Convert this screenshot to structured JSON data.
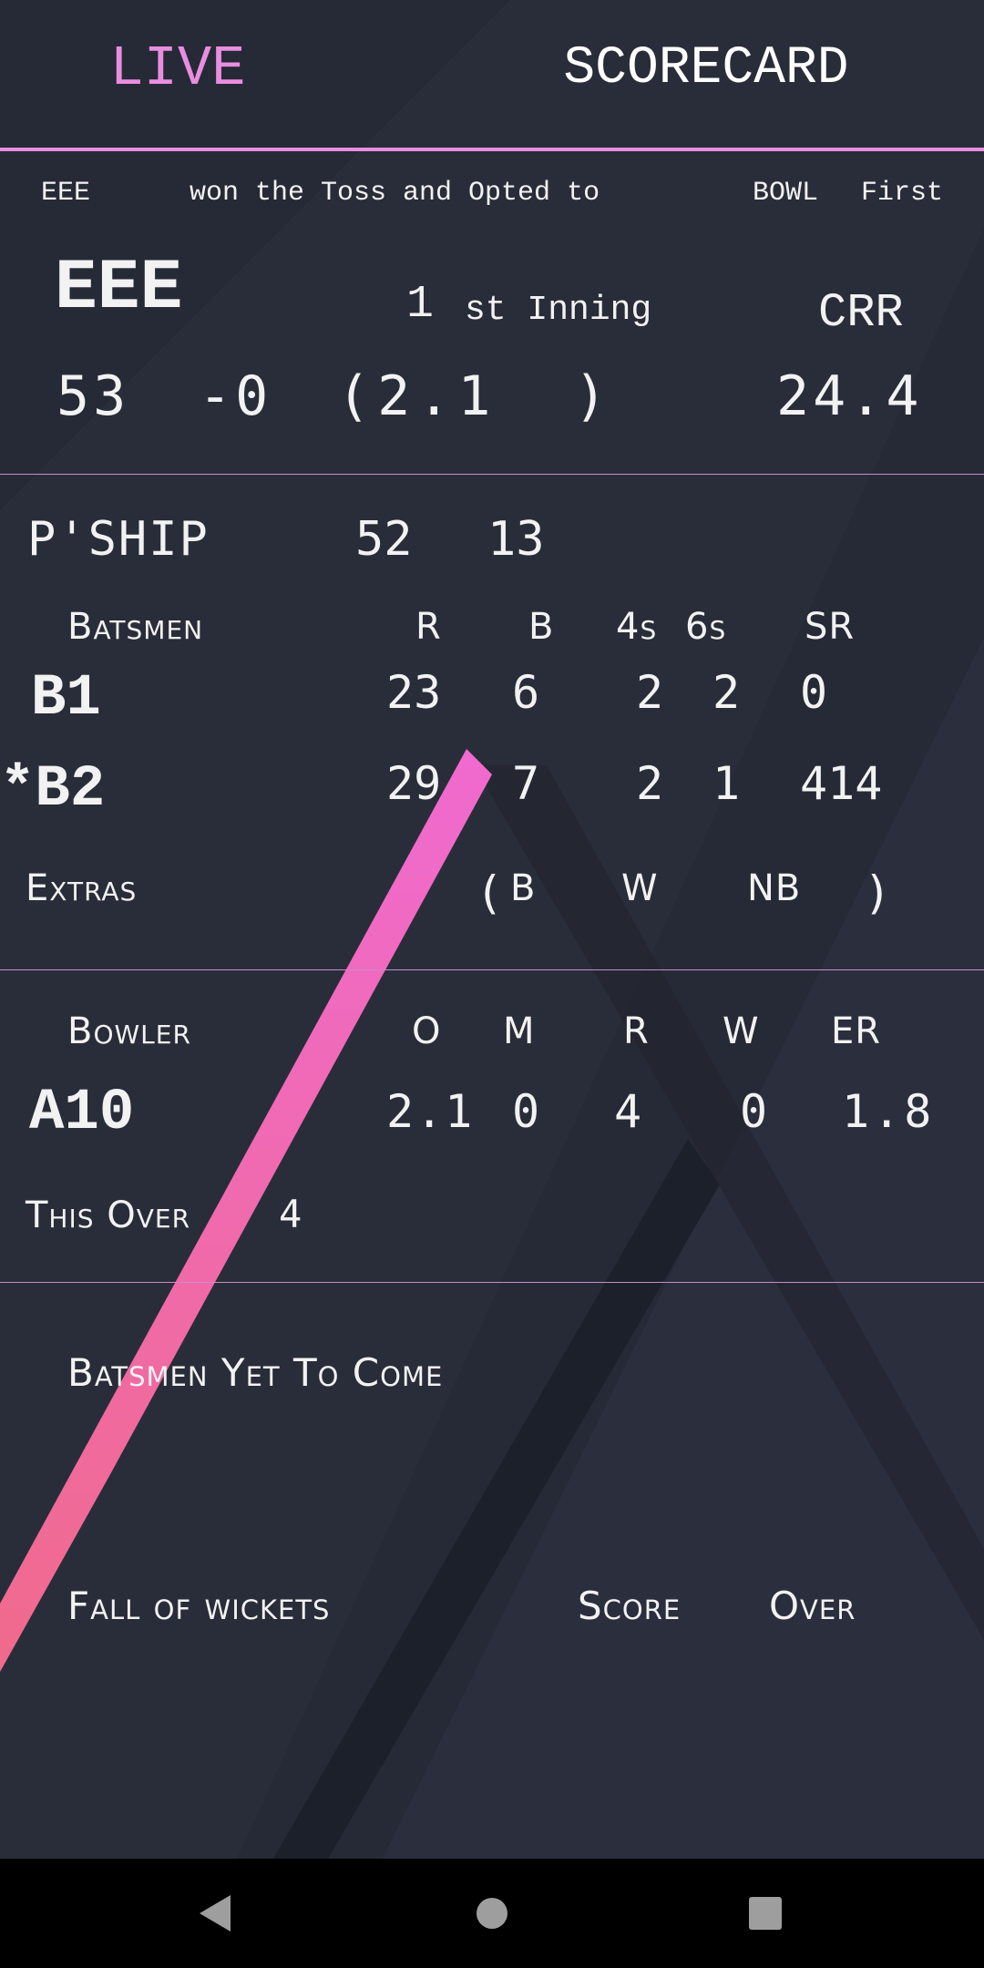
{
  "tabs": {
    "live": "LIVE",
    "scorecard": "SCORECARD"
  },
  "colors": {
    "accent": "#e88ee0",
    "background": "#262a36",
    "stripe_top": "#f06ad0",
    "stripe_bottom": "#f06a8c",
    "divider": "#c98bcf"
  },
  "toss": {
    "team": "EEE",
    "text": "won the Toss and Opted to",
    "choice": "BOWL",
    "suffix": "First"
  },
  "innings": {
    "team": "EEE",
    "number": "1",
    "ordinal": "st Inning",
    "runs": "53",
    "wickets": "-0",
    "overs_open": "(2.1",
    "overs_close": ")",
    "crr_label": "CRR",
    "crr": "24.4"
  },
  "partnership": {
    "label": "P'SHIP",
    "runs": "52",
    "balls": "13"
  },
  "batting": {
    "headers": {
      "name": "Batsmen",
      "r": "R",
      "b": "B",
      "fours": "4s",
      "sixes": "6s",
      "sr": "SR"
    },
    "rows": [
      {
        "name": "B1",
        "r": "23",
        "b": "6",
        "fours": "2",
        "sixes": "2",
        "sr": "0"
      },
      {
        "name": "*B2",
        "r": "29",
        "b": "7",
        "fours": "2",
        "sixes": "1",
        "sr": "414"
      }
    ],
    "extras": {
      "label": "Extras",
      "open": "(",
      "b": "B",
      "w": "W",
      "nb": "NB",
      "close": ")"
    }
  },
  "bowling": {
    "headers": {
      "name": "Bowler",
      "o": "O",
      "m": "M",
      "r": "R",
      "w": "W",
      "er": "ER"
    },
    "row": {
      "name": "A10",
      "o": "2.1",
      "m": "0",
      "r": "4",
      "w": "0",
      "er": "1.8"
    },
    "this_over_label": "This Over",
    "this_over_value": "4"
  },
  "yet_to_come": {
    "label": "Batsmen Yet To Come"
  },
  "fall_of_wickets": {
    "label": "Fall of wickets",
    "score": "Score",
    "over": "Over"
  },
  "nav": {
    "back": "back-icon",
    "home": "home-icon",
    "recents": "recents-icon"
  }
}
